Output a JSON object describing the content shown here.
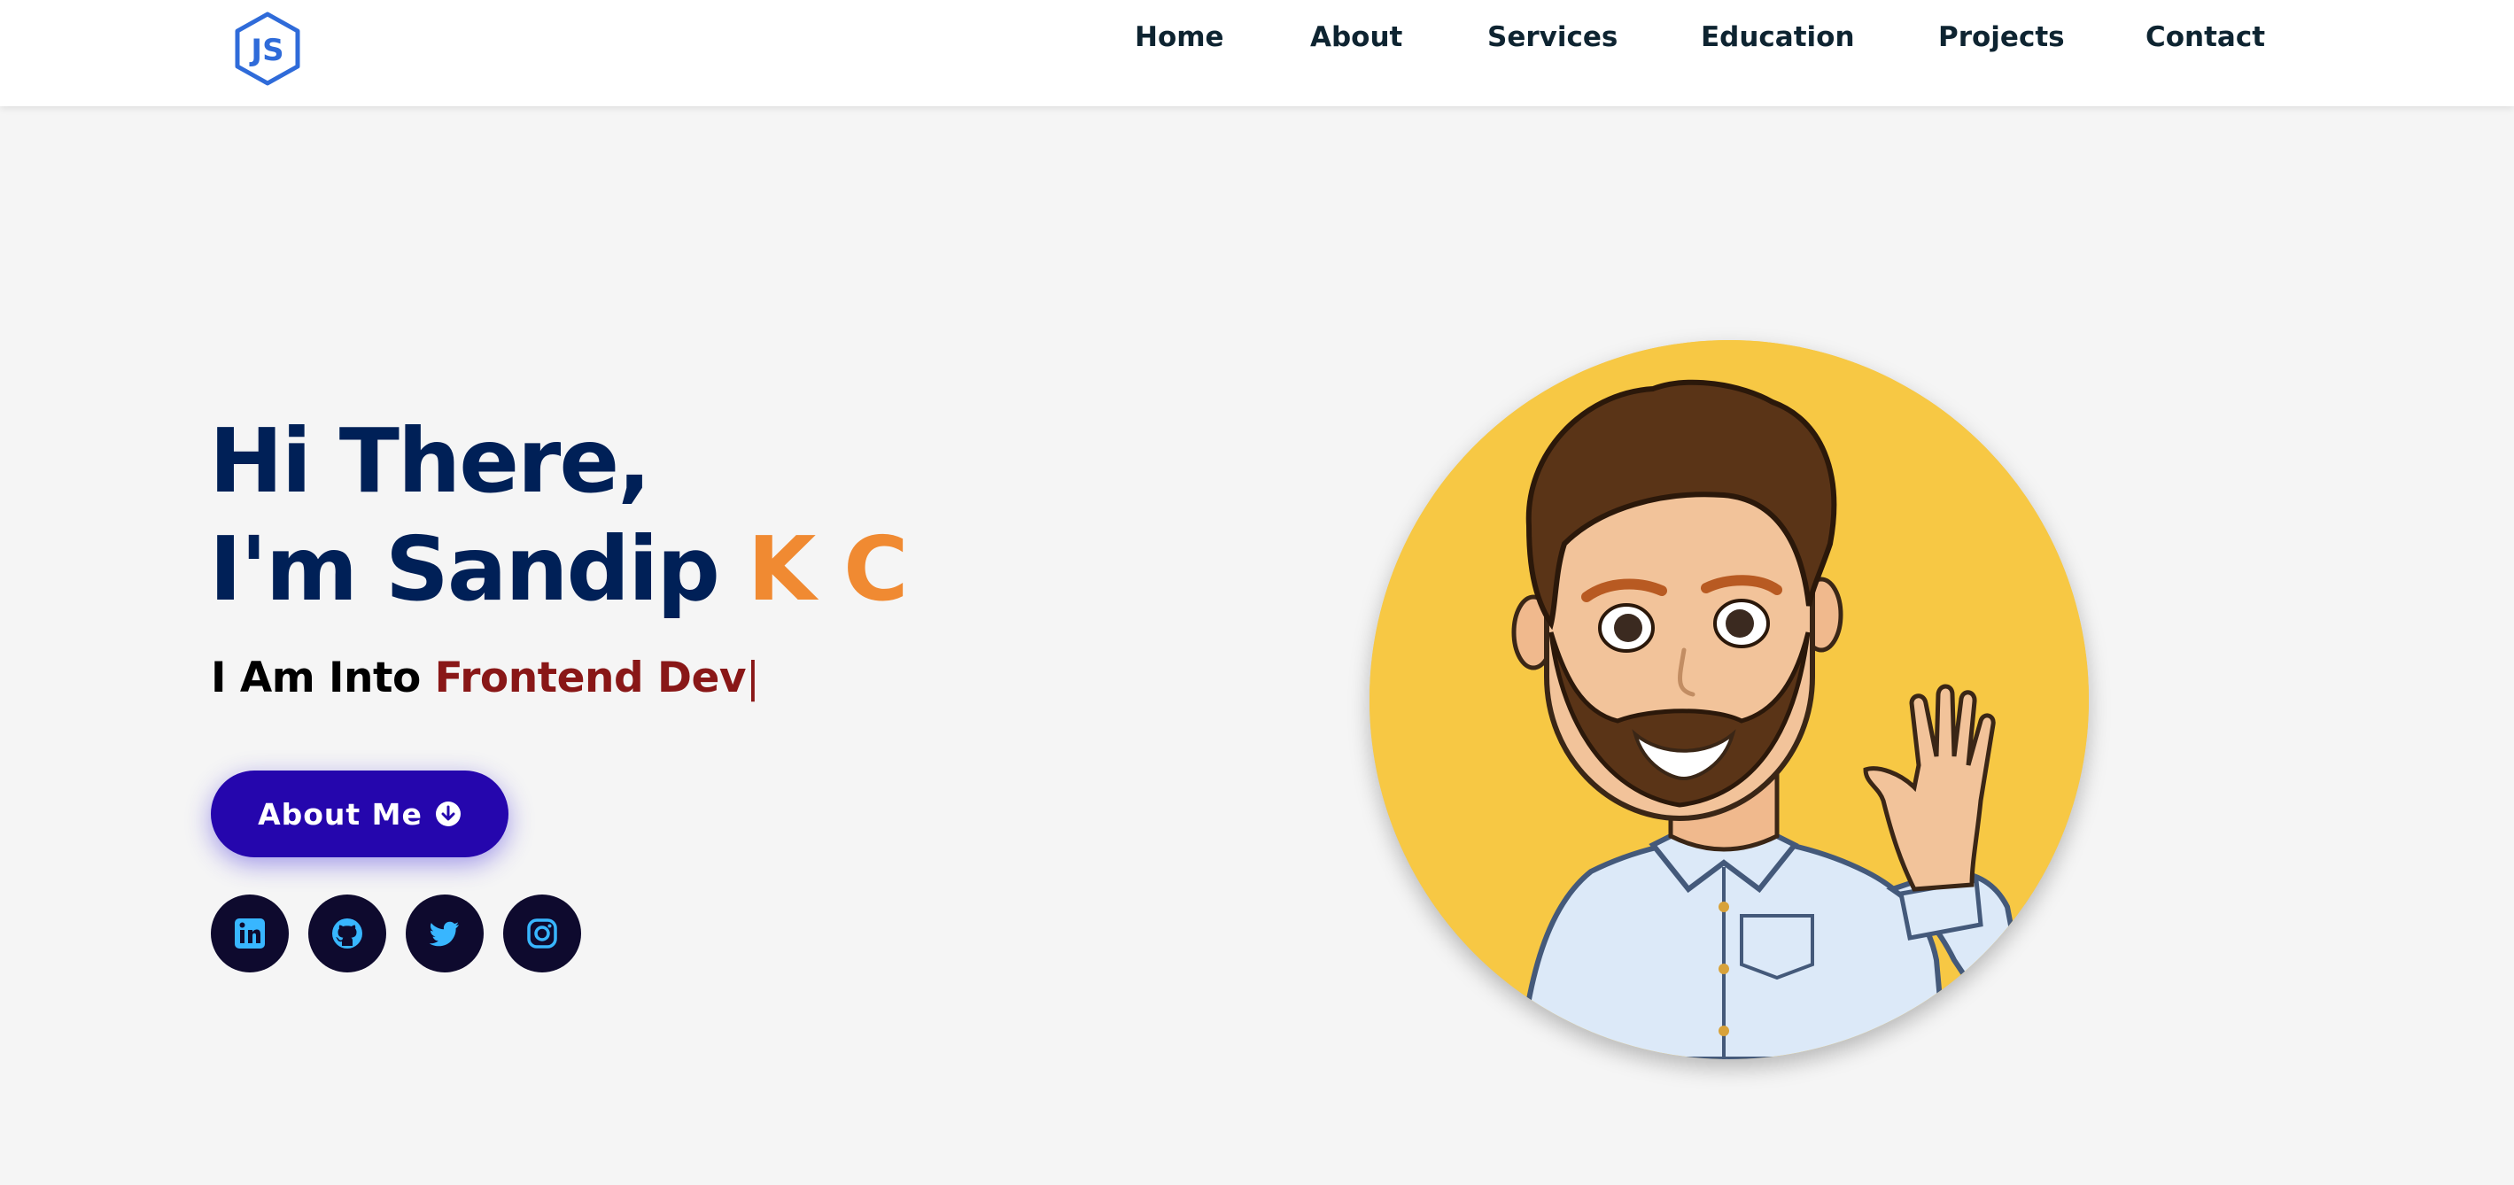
{
  "header": {
    "logo_text": "JS",
    "nav": [
      "Home",
      "About",
      "Services",
      "Education",
      "Projects",
      "Contact"
    ]
  },
  "hero": {
    "greeting": "Hi There,",
    "name_prefix": "I'm Sandip ",
    "name_accent": "K C",
    "typed_prefix": "I Am Into ",
    "typed_value": "Frontend Dev",
    "cursor": "|",
    "button_label": "About Me"
  },
  "socials": [
    {
      "icon": "linkedin-icon"
    },
    {
      "icon": "github-icon"
    },
    {
      "icon": "twitter-icon"
    },
    {
      "icon": "instagram-icon"
    }
  ],
  "colors": {
    "title": "#002057",
    "accent": "#f08a32",
    "typed": "#891717",
    "button": "#2506ad",
    "social_bg": "#0e0a2e",
    "social_icon": "#38b6ff",
    "avatar_bg": "#f7c844"
  }
}
